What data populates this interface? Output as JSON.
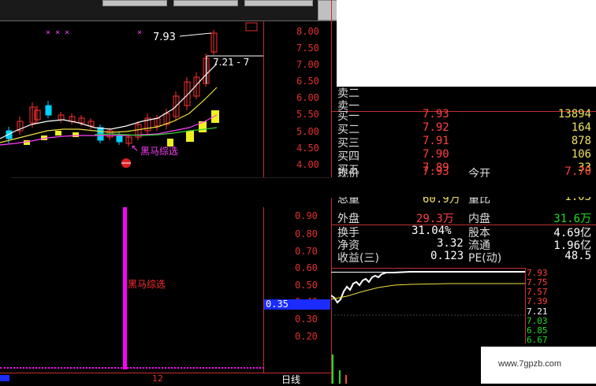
{
  "main_chart": {
    "high_label": "7.93",
    "range_label": "7.21 - 7",
    "y_ticks": [
      "8.00",
      "7.50",
      "7.00",
      "6.50",
      "6.00",
      "5.50",
      "5.00",
      "4.50",
      "4.00"
    ],
    "indicator_label": "黑马综选",
    "x_markers": "× × ×",
    "x_marker_single": "×"
  },
  "osc_panel": {
    "label": "黑马综选",
    "y_ticks": [
      "0.90",
      "0.80",
      "0.70",
      "0.60",
      "0.50",
      "0.40",
      "0.30",
      "0.20"
    ],
    "current_value": "0.35",
    "x_tick": "12"
  },
  "bottom_tab": {
    "label": "日线"
  },
  "quote": {
    "ask_rows": [
      {
        "label": "卖二"
      },
      {
        "label": "卖一"
      }
    ],
    "bid_rows": [
      {
        "label": "买一",
        "price": "7.93",
        "volume": "13894"
      },
      {
        "label": "买二",
        "price": "7.92",
        "volume": "164"
      },
      {
        "label": "买三",
        "price": "7.91",
        "volume": "878"
      },
      {
        "label": "买四",
        "price": "7.90",
        "volume": "106"
      },
      {
        "label": "买五",
        "price": "7.89",
        "volume": "33"
      }
    ],
    "current": {
      "label": "现价",
      "value": "7.93",
      "open_label": "今开",
      "open_value": "7.70"
    },
    "partial": {
      "left": "总量",
      "left_val": "60.9万",
      "right": "量比",
      "right_val": "1.03"
    },
    "outer": {
      "label": "外盘",
      "value": "29.3万",
      "label2": "内盘",
      "value2": "31.6万"
    },
    "turnover": {
      "label": "换手",
      "value": "31.04%",
      "label2": "股本",
      "value2": "4.69亿"
    },
    "netasset": {
      "label": "净资",
      "value": "3.32",
      "label2": "流通",
      "value2": "1.96亿"
    },
    "eps": {
      "label": "收益(三)",
      "value": "0.123",
      "label2": "PE(动)",
      "value2": "48.5"
    }
  },
  "mini_chart": {
    "labels": [
      "7.93",
      "7.75",
      "7.57",
      "7.39",
      "7.21",
      "7.03",
      "6.85",
      "6.67"
    ],
    "colors": [
      "#ff4040",
      "#ff4040",
      "#ff4040",
      "#ff4040",
      "#ffffff",
      "#22dd22",
      "#22dd22",
      "#22dd22"
    ]
  },
  "watermark": "www.7gpzb.com",
  "colors": {
    "up": "#ff3030",
    "down": "#00d0ff",
    "ma1": "#ffffff",
    "ma2": "#f0e040",
    "ma3": "#ff40ff",
    "ma4": "#30d030",
    "indicator": "#ff00ff",
    "highlight": "#1a2cff"
  }
}
